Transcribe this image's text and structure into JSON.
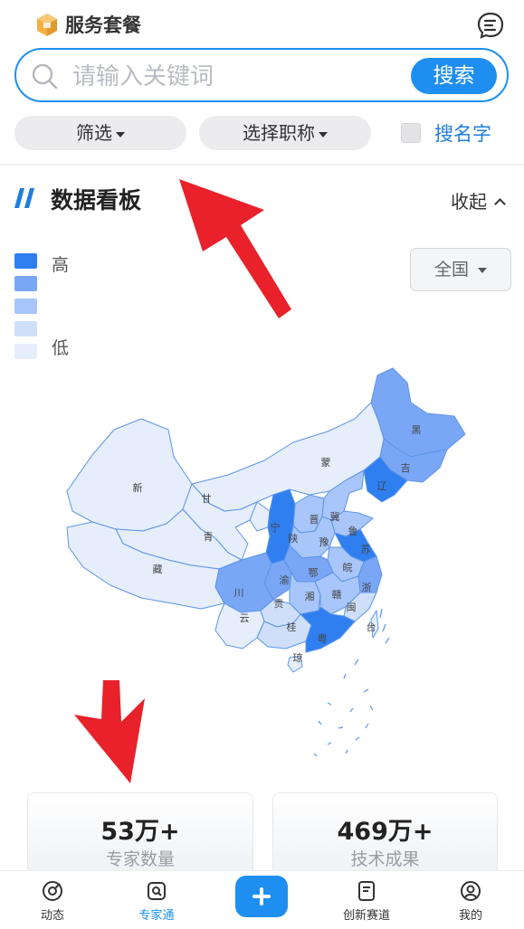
{
  "header": {
    "service_label": "服务套餐"
  },
  "search": {
    "placeholder": "请输入关键词",
    "button": "搜索"
  },
  "filters": {
    "filter_label": "筛选",
    "title_label": "选择职称",
    "name_search_label": "搜名字"
  },
  "board": {
    "title": "数据看板",
    "collapse_label": "收起"
  },
  "legend": {
    "high": "高",
    "low": "低",
    "colors": [
      "#2f7ff0",
      "#7aa7f5",
      "#a8c6fa",
      "#cfdff9",
      "#e6eefc"
    ]
  },
  "region": {
    "selected": "全国"
  },
  "map": {
    "provinces": [
      {
        "name": "黑",
        "level": 2
      },
      {
        "name": "吉",
        "level": 2
      },
      {
        "name": "辽",
        "level": 1
      },
      {
        "name": "蒙",
        "level": 5
      },
      {
        "name": "新",
        "level": 5
      },
      {
        "name": "甘",
        "level": 5
      },
      {
        "name": "青",
        "level": 5
      },
      {
        "name": "藏",
        "level": 5
      },
      {
        "name": "宁",
        "level": 5
      },
      {
        "name": "晋",
        "level": 3
      },
      {
        "name": "冀",
        "level": 3
      },
      {
        "name": "鲁",
        "level": 3
      },
      {
        "name": "豫",
        "level": 3
      },
      {
        "name": "苏",
        "level": 1
      },
      {
        "name": "皖",
        "level": 3
      },
      {
        "name": "浙",
        "level": 2
      },
      {
        "name": "陕",
        "level": 1
      },
      {
        "name": "川",
        "level": 2
      },
      {
        "name": "渝",
        "level": 2
      },
      {
        "name": "鄂",
        "level": 2
      },
      {
        "name": "湘",
        "level": 3
      },
      {
        "name": "赣",
        "level": 3
      },
      {
        "name": "闽",
        "level": 4
      },
      {
        "name": "贵",
        "level": 4
      },
      {
        "name": "云",
        "level": 5
      },
      {
        "name": "桂",
        "level": 4
      },
      {
        "name": "粤",
        "level": 1
      },
      {
        "name": "台",
        "level": 5
      },
      {
        "name": "琼",
        "level": 5
      }
    ]
  },
  "stats": [
    {
      "value": "53万+",
      "label": "专家数量"
    },
    {
      "value": "469万+",
      "label": "技术成果"
    }
  ],
  "tabbar": {
    "items": [
      "动态",
      "专家通",
      "创新赛道",
      "我的"
    ],
    "active": "专家通"
  }
}
